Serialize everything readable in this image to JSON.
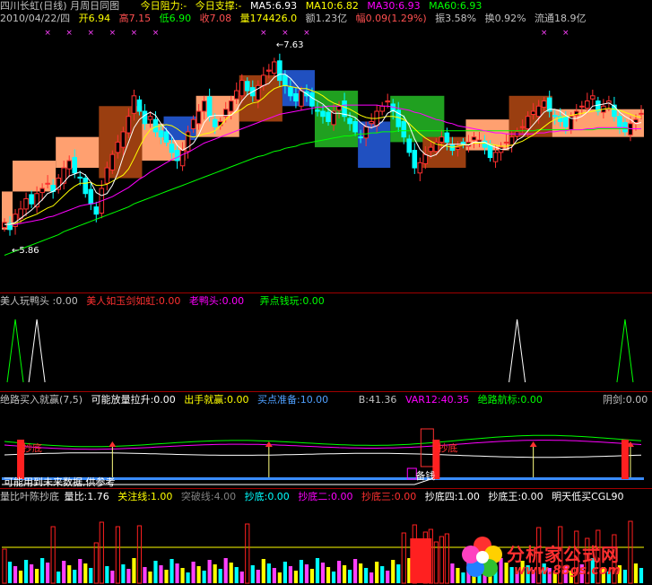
{
  "main": {
    "title": "四川长虹(日线) 月周日同图",
    "resist": "今日阻力:-",
    "support": "今日支撑:-",
    "ma": [
      {
        "label": "MA5:6.93",
        "color": "#ffffff"
      },
      {
        "label": "MA10:6.82",
        "color": "#ffff00"
      },
      {
        "label": "MA30:6.93",
        "color": "#ff00ff"
      },
      {
        "label": "MA60:6.93",
        "color": "#00ff00"
      }
    ],
    "info": [
      {
        "text": "2010/04/22/四",
        "color": "#c0c0c0"
      },
      {
        "text": "开6.94",
        "color": "#ffff00"
      },
      {
        "text": "高7.15",
        "color": "#ff5050"
      },
      {
        "text": "低6.90",
        "color": "#00ff00"
      },
      {
        "text": "收7.08",
        "color": "#ff5050"
      },
      {
        "text": "量174426.0",
        "color": "#ffff00"
      },
      {
        "text": "额1.23亿",
        "color": "#c0c0c0"
      },
      {
        "text": "幅0.09(1.29%)",
        "color": "#ff5050"
      },
      {
        "text": "振3.58%",
        "color": "#c0c0c0"
      },
      {
        "text": "换0.92%",
        "color": "#c0c0c0"
      },
      {
        "text": "流通18.9亿",
        "color": "#c0c0c0"
      }
    ],
    "price_high_label": "7.63",
    "price_low_label": "5.86"
  },
  "panel2": {
    "title": "美人玩鸭头 :0.00",
    "items": [
      {
        "text": "美人如玉剑如虹:0.00",
        "color": "#ff3030"
      },
      {
        "text": "老鸭头:0.00",
        "color": "#ff00ff"
      },
      {
        "text": "弄点钱玩:0.00",
        "color": "#00ff00"
      }
    ]
  },
  "panel3": {
    "title": "绝路买入就赢(7,5)",
    "items": [
      {
        "text": "可能放量拉升:0.00",
        "color": "#ffffff"
      },
      {
        "text": "出手就赢:0.00",
        "color": "#ffff00"
      },
      {
        "text": "买点准备:10.00",
        "color": "#4fa0ff"
      },
      {
        "text": "B:41.36",
        "color": "#c0c0c0"
      },
      {
        "text": "VAR12:40.35",
        "color": "#ff00ff"
      },
      {
        "text": "绝路航标:0.00",
        "color": "#00ff00"
      },
      {
        "text": "阴剑:0.00",
        "color": "#c0c0c0"
      }
    ],
    "notes": [
      "抄底",
      "抄底",
      "备钱",
      "可能用到未来数据,供参考"
    ]
  },
  "panel4": {
    "items": [
      {
        "text": "量比叶陈抄底",
        "color": "#c0c0c0"
      },
      {
        "text": "量比:1.76",
        "color": "#ffffff"
      },
      {
        "text": "关注线:1.00",
        "color": "#ffff00"
      },
      {
        "text": "突破线:4.00",
        "color": "#808080"
      },
      {
        "text": "抄底:0.00",
        "color": "#00ffff"
      },
      {
        "text": "抄底二:0.00",
        "color": "#ff00ff"
      },
      {
        "text": "抄底三:0.00",
        "color": "#ff3030"
      },
      {
        "text": "抄底四:1.00",
        "color": "#ffffff"
      },
      {
        "text": "抄底王:0.00",
        "color": "#ffffff"
      },
      {
        "text": "明天低买CGL90",
        "color": "#ffffff"
      }
    ]
  },
  "watermark": {
    "title": "分析家公式网",
    "url": "www.88gs.com"
  },
  "chart_data": {
    "type": "candlestick",
    "n": 119,
    "ylim": [
      5.6,
      7.85
    ],
    "panel_colors": {
      "up": "#ff3030",
      "down": "#00ffff",
      "ma5": "#ffffff",
      "ma10": "#ffff00",
      "ma30": "#ff00ff",
      "ma60": "#00ff00"
    },
    "close": [
      6.02,
      5.95,
      6.1,
      6.15,
      6.25,
      6.2,
      6.3,
      6.35,
      6.4,
      6.32,
      6.45,
      6.55,
      6.62,
      6.5,
      6.45,
      6.3,
      6.2,
      6.1,
      6.35,
      6.55,
      6.68,
      6.8,
      6.9,
      7.05,
      7.25,
      7.1,
      6.98,
      7.05,
      6.9,
      6.85,
      6.8,
      6.7,
      6.62,
      6.72,
      6.9,
      7.02,
      7.1,
      7.2,
      7.05,
      6.95,
      7.0,
      7.12,
      7.2,
      7.3,
      7.4,
      7.3,
      7.25,
      7.35,
      7.45,
      7.5,
      7.58,
      7.4,
      7.35,
      7.25,
      7.2,
      7.3,
      7.25,
      7.15,
      7.1,
      7.05,
      7.0,
      7.1,
      7.15,
      7.05,
      6.98,
      6.9,
      6.85,
      6.95,
      7.0,
      7.1,
      7.15,
      7.2,
      7.1,
      6.95,
      6.85,
      6.7,
      6.55,
      6.6,
      6.68,
      6.75,
      6.8,
      6.85,
      6.8,
      6.72,
      6.75,
      6.78,
      6.8,
      6.85,
      6.82,
      6.75,
      6.65,
      6.7,
      6.75,
      6.8,
      6.85,
      6.9,
      6.95,
      7.05,
      7.1,
      7.15,
      7.2,
      7.1,
      7.05,
      7.0,
      6.95,
      7.05,
      7.1,
      7.15,
      7.2,
      7.25,
      7.1,
      7.15,
      7.2,
      7.05,
      6.95,
      6.9,
      6.98,
      7.02,
      7.08
    ],
    "ma5": [
      6.0,
      6.0,
      6.02,
      6.06,
      6.1,
      6.14,
      6.19,
      6.24,
      6.3,
      6.32,
      6.36,
      6.41,
      6.47,
      6.49,
      6.51,
      6.48,
      6.41,
      6.31,
      6.28,
      6.3,
      6.38,
      6.5,
      6.66,
      6.8,
      6.94,
      7.02,
      7.06,
      7.09,
      7.06,
      6.98,
      6.92,
      6.86,
      6.77,
      6.72,
      6.75,
      6.79,
      6.87,
      6.99,
      7.05,
      7.06,
      7.06,
      7.06,
      7.06,
      7.11,
      7.2,
      7.26,
      7.29,
      7.32,
      7.35,
      7.37,
      7.43,
      7.46,
      7.46,
      7.42,
      7.36,
      7.3,
      7.27,
      7.23,
      7.2,
      7.17,
      7.12,
      7.08,
      7.08,
      7.07,
      7.06,
      7.04,
      6.99,
      6.95,
      6.94,
      6.96,
      7.0,
      7.08,
      7.11,
      7.08,
      7.05,
      6.96,
      6.83,
      6.73,
      6.68,
      6.66,
      6.68,
      6.74,
      6.78,
      6.78,
      6.78,
      6.78,
      6.77,
      6.8,
      6.8,
      6.8,
      6.77,
      6.75,
      6.73,
      6.73,
      6.75,
      6.82,
      6.85,
      6.91,
      6.97,
      7.03,
      7.09,
      7.12,
      7.12,
      7.1,
      7.06,
      7.03,
      7.03,
      7.05,
      7.09,
      7.15,
      7.16,
      7.17,
      7.18,
      7.15,
      7.09,
      7.05,
      7.02,
      6.98,
      6.99
    ],
    "ma10": [
      6.0,
      6.0,
      6.01,
      6.03,
      6.06,
      6.08,
      6.1,
      6.13,
      6.16,
      6.18,
      6.23,
      6.28,
      6.33,
      6.37,
      6.4,
      6.4,
      6.41,
      6.38,
      6.38,
      6.39,
      6.42,
      6.45,
      6.48,
      6.54,
      6.64,
      6.75,
      6.85,
      6.92,
      6.95,
      6.96,
      6.97,
      6.96,
      6.93,
      6.89,
      6.86,
      6.85,
      6.86,
      6.88,
      6.89,
      6.91,
      6.96,
      7.02,
      7.07,
      7.09,
      7.12,
      7.16,
      7.18,
      7.19,
      7.23,
      7.28,
      7.32,
      7.34,
      7.35,
      7.34,
      7.33,
      7.32,
      7.32,
      7.3,
      7.28,
      7.25,
      7.21,
      7.18,
      7.16,
      7.14,
      7.12,
      7.09,
      7.06,
      7.04,
      7.03,
      7.03,
      7.04,
      7.05,
      7.05,
      7.04,
      7.02,
      6.98,
      6.93,
      6.88,
      6.84,
      6.81,
      6.78,
      6.77,
      6.76,
      6.75,
      6.76,
      6.77,
      6.78,
      6.79,
      6.79,
      6.79,
      6.78,
      6.77,
      6.76,
      6.76,
      6.77,
      6.79,
      6.81,
      6.84,
      6.87,
      6.91,
      6.95,
      6.99,
      7.02,
      7.04,
      7.05,
      7.06,
      7.07,
      7.08,
      7.09,
      7.1,
      7.11,
      7.12,
      7.13,
      7.12,
      7.11,
      7.09,
      7.07,
      7.05,
      7.04
    ],
    "ma30": [
      6.0,
      6.0,
      6.0,
      6.01,
      6.02,
      6.03,
      6.04,
      6.05,
      6.07,
      6.08,
      6.1,
      6.12,
      6.14,
      6.16,
      6.18,
      6.19,
      6.2,
      6.21,
      6.23,
      6.25,
      6.27,
      6.3,
      6.33,
      6.36,
      6.4,
      6.44,
      6.47,
      6.51,
      6.54,
      6.57,
      6.6,
      6.63,
      6.65,
      6.68,
      6.7,
      6.73,
      6.76,
      6.79,
      6.81,
      6.83,
      6.85,
      6.87,
      6.89,
      6.91,
      6.93,
      6.95,
      6.97,
      6.99,
      7.01,
      7.03,
      7.05,
      7.07,
      7.08,
      7.09,
      7.1,
      7.11,
      7.12,
      7.13,
      7.14,
      7.14,
      7.15,
      7.15,
      7.15,
      7.16,
      7.16,
      7.16,
      7.16,
      7.16,
      7.16,
      7.16,
      7.15,
      7.15,
      7.14,
      7.13,
      7.12,
      7.11,
      7.09,
      7.08,
      7.06,
      7.04,
      7.02,
      7.01,
      6.99,
      6.98,
      6.96,
      6.95,
      6.94,
      6.93,
      6.92,
      6.91,
      6.9,
      6.89,
      6.89,
      6.88,
      6.88,
      6.88,
      6.88,
      6.88,
      6.88,
      6.89,
      6.89,
      6.9,
      6.9,
      6.91,
      6.91,
      6.92,
      6.92,
      6.92,
      6.93,
      6.93,
      6.94,
      6.94,
      6.94,
      6.94,
      6.94,
      6.94,
      6.93,
      6.93,
      6.93
    ],
    "ma60": [
      5.7,
      5.72,
      5.74,
      5.76,
      5.78,
      5.8,
      5.82,
      5.84,
      5.86,
      5.88,
      5.9,
      5.93,
      5.95,
      5.97,
      5.99,
      6.01,
      6.03,
      6.05,
      6.07,
      6.09,
      6.11,
      6.13,
      6.15,
      6.17,
      6.2,
      6.22,
      6.24,
      6.26,
      6.28,
      6.3,
      6.32,
      6.34,
      6.36,
      6.38,
      6.4,
      6.42,
      6.44,
      6.46,
      6.48,
      6.5,
      6.52,
      6.54,
      6.56,
      6.58,
      6.6,
      6.62,
      6.64,
      6.66,
      6.67,
      6.69,
      6.71,
      6.72,
      6.74,
      6.75,
      6.76,
      6.78,
      6.79,
      6.8,
      6.81,
      6.82,
      6.83,
      6.84,
      6.85,
      6.86,
      6.86,
      6.87,
      6.88,
      6.88,
      6.89,
      6.89,
      6.9,
      6.9,
      6.9,
      6.91,
      6.91,
      6.91,
      6.91,
      6.91,
      6.91,
      6.91,
      6.91,
      6.91,
      6.91,
      6.91,
      6.91,
      6.91,
      6.91,
      6.91,
      6.91,
      6.91,
      6.91,
      6.91,
      6.91,
      6.91,
      6.91,
      6.91,
      6.91,
      6.91,
      6.91,
      6.92,
      6.92,
      6.92,
      6.92,
      6.92,
      6.92,
      6.92,
      6.92,
      6.92,
      6.92,
      6.92,
      6.93,
      6.93,
      6.93,
      6.93,
      6.93,
      6.93,
      6.93,
      6.93,
      6.93
    ],
    "bands": [
      {
        "from": 0,
        "to": 2,
        "low": 5.95,
        "high": 6.32,
        "color": "#ffa070"
      },
      {
        "from": 2,
        "to": 10,
        "low": 6.32,
        "high": 6.62,
        "color": "#ffa070"
      },
      {
        "from": 10,
        "to": 18,
        "low": 6.55,
        "high": 6.85,
        "color": "#ffa070"
      },
      {
        "from": 18,
        "to": 26,
        "low": 6.45,
        "high": 7.15,
        "color": "#9a3e10"
      },
      {
        "from": 26,
        "to": 34,
        "low": 6.62,
        "high": 6.98,
        "color": "#ffa070"
      },
      {
        "from": 30,
        "to": 36,
        "low": 6.82,
        "high": 7.05,
        "color": "#2050c0"
      },
      {
        "from": 36,
        "to": 44,
        "low": 6.85,
        "high": 7.25,
        "color": "#ffa070"
      },
      {
        "from": 44,
        "to": 52,
        "low": 7.0,
        "high": 7.45,
        "color": "#9a3e10"
      },
      {
        "from": 52,
        "to": 58,
        "low": 7.15,
        "high": 7.5,
        "color": "#2050c0"
      },
      {
        "from": 58,
        "to": 66,
        "low": 6.75,
        "high": 7.3,
        "color": "#20a020"
      },
      {
        "from": 66,
        "to": 72,
        "low": 6.55,
        "high": 7.0,
        "color": "#2050c0"
      },
      {
        "from": 72,
        "to": 82,
        "low": 6.8,
        "high": 7.25,
        "color": "#20a020"
      },
      {
        "from": 78,
        "to": 86,
        "low": 6.55,
        "high": 6.85,
        "color": "#9a3e10"
      },
      {
        "from": 86,
        "to": 94,
        "low": 6.72,
        "high": 7.02,
        "color": "#ffa070"
      },
      {
        "from": 94,
        "to": 102,
        "low": 6.85,
        "high": 7.25,
        "color": "#9a3e10"
      },
      {
        "from": 102,
        "to": 119,
        "low": 6.85,
        "high": 7.12,
        "color": "#ffa070"
      }
    ],
    "panel2_spikes": [
      {
        "i": 2,
        "color": "#00ff00"
      },
      {
        "i": 6,
        "color": "#ffffff"
      },
      {
        "i": 95,
        "color": "#ffffff"
      },
      {
        "i": 115,
        "color": "#00ff00"
      }
    ],
    "panel3_arrows": [
      20,
      49,
      98,
      116
    ],
    "panel3_red_bars": [
      {
        "i": 3,
        "label": "抄底"
      },
      {
        "i": 80,
        "label": "抄底"
      },
      {
        "i": 115,
        "label": ""
      }
    ],
    "panel4_red_bars": [
      0,
      9,
      17,
      18,
      21,
      25,
      45,
      74,
      76,
      78,
      79,
      80,
      81,
      82,
      99,
      103,
      106,
      108,
      110,
      113,
      116
    ]
  }
}
